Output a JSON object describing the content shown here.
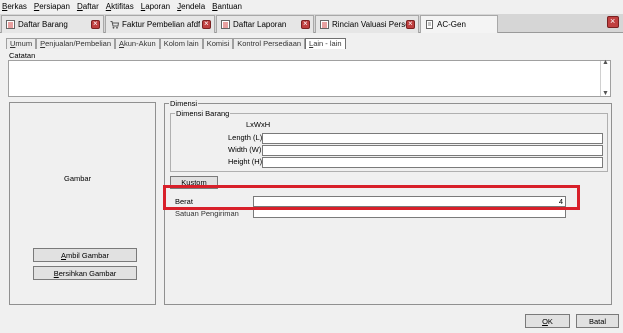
{
  "menu": [
    "Berkas",
    "Persiapan",
    "Daftar",
    "Aktifitas",
    "Laporan",
    "Jendela",
    "Bantuan"
  ],
  "doc_tabs": [
    {
      "label": "Daftar Barang",
      "icon": "list-icon"
    },
    {
      "label": "Faktur Pembelian afdf",
      "icon": "cart-icon"
    },
    {
      "label": "Daftar Laporan",
      "icon": "list-icon"
    },
    {
      "label": "Rincian Valuasi Persed...",
      "icon": "list-icon"
    },
    {
      "label": "AC-Gen",
      "icon": "document-icon"
    }
  ],
  "sub_tabs": [
    "Umum",
    "Penjualan/Pembelian",
    "Akun-Akun",
    "Kolom lain",
    "Komisi",
    "Kontrol Persediaan",
    "Lain - lain"
  ],
  "catatan": {
    "label": "Catatan",
    "value": ""
  },
  "gambar": {
    "label": "Gambar",
    "ambil_button": "Ambil Gambar",
    "bersihkan_button": "Bersihkan Gambar"
  },
  "dimensi": {
    "legend": "Dimensi",
    "barang_legend": "Dimensi Barang",
    "lxwxh": "LxWxH",
    "length_label": "Length (L)",
    "width_label": "Width (W)",
    "height_label": "Height (H)",
    "kustom_button": "Kustom",
    "berat_label": "Berat",
    "berat_value": "4",
    "satuan_label": "Satuan Pengiriman"
  },
  "footer": {
    "ok": "OK",
    "batal": "Batal"
  },
  "colors": {
    "highlight": "#d8202a"
  }
}
